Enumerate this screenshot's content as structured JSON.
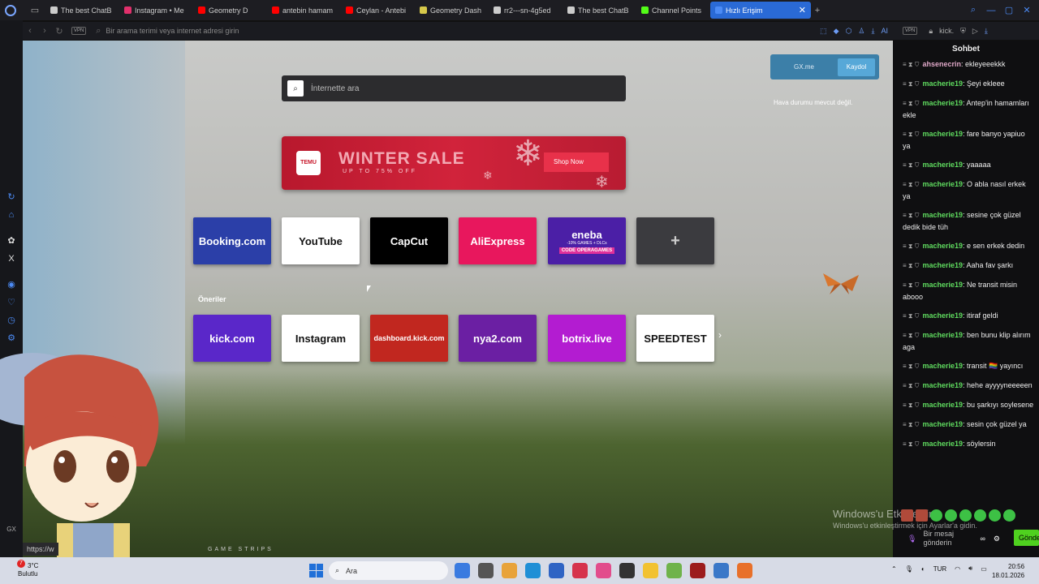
{
  "tabs": [
    {
      "label": "The best ChatB",
      "color": "#cccccc"
    },
    {
      "label": "Instagram • Me",
      "color": "#e1306c"
    },
    {
      "label": "Geometry D",
      "color": "#ff0000"
    },
    {
      "label": "antebin hamam",
      "color": "#ff0000"
    },
    {
      "label": "Ceylan - Antebi",
      "color": "#ff0000"
    },
    {
      "label": "Geometry Dash",
      "color": "#d6c84a"
    },
    {
      "label": "rr2---sn-4g5ed",
      "color": "#cccccc"
    },
    {
      "label": "The best ChatB",
      "color": "#cccccc"
    },
    {
      "label": "Channel Points",
      "color": "#53fc18"
    },
    {
      "label": "Hızlı Erişim",
      "color": "#4c8bf5",
      "active": true
    }
  ],
  "address": {
    "placeholder": "Bir arama terimi veya internet adresi girin",
    "vpn": "VPN",
    "ai": "AI"
  },
  "chat_top": {
    "vpn": "VPN",
    "site": "kick."
  },
  "speeddial": {
    "search_placeholder": "İnternette ara",
    "ad": {
      "title": "WINTER SALE",
      "subtitle": "UP TO 75% OFF",
      "cta": "Shop Now",
      "brand": "TEMU"
    },
    "gx": {
      "label": "GX.me",
      "button": "Kaydol"
    },
    "weather": "Hava durumu mevcut değil.",
    "suggestions_label": "Öneriler",
    "row1": [
      {
        "label": "Booking.com",
        "bg": "#2b3fa8",
        "fg": "#ffffff"
      },
      {
        "label": "YouTube",
        "bg": "#ffffff",
        "fg": "#111111"
      },
      {
        "label": "CapCut",
        "bg": "#000000",
        "fg": "#ffffff"
      },
      {
        "label": "AliExpress",
        "bg": "#e8175d",
        "fg": "#ffffff"
      },
      {
        "label": "eneba",
        "bg": "#4b1fa6",
        "fg": "#ffffff"
      },
      {
        "label": "+",
        "bg": "#3b3b3f",
        "fg": "#cccccc"
      }
    ],
    "row2": [
      {
        "label": "kick.com",
        "bg": "#5a27c9",
        "fg": "#ffffff"
      },
      {
        "label": "Instagram",
        "bg": "#ffffff",
        "fg": "#111111"
      },
      {
        "label": "dashboard.kick.com",
        "bg": "#c1271f",
        "fg": "#ffffff"
      },
      {
        "label": "nya2.com",
        "bg": "#6b1fa3",
        "fg": "#ffffff"
      },
      {
        "label": "botrix.live",
        "bg": "#b31cd1",
        "fg": "#ffffff"
      },
      {
        "label": "SPEEDTEST",
        "bg": "#ffffff",
        "fg": "#111111"
      }
    ],
    "eneba_sub": "-10% GAMES + DLCs",
    "eneba_code": "CODE OPERAGAMES",
    "game_strips": "GAME STRIPS",
    "url_hint": "https://w"
  },
  "chat": {
    "title": "Sohbet",
    "messages": [
      {
        "user": "ahsenecrin",
        "text": "ekleyeeekkk"
      },
      {
        "user": "macherie19",
        "text": "Şeyi ekleee"
      },
      {
        "user": "macherie19",
        "text": "Antep'in hamamları ekle"
      },
      {
        "user": "macherie19",
        "text": "fare banyo yapiuo ya"
      },
      {
        "user": "macherie19",
        "text": "yaaaaa"
      },
      {
        "user": "macherie19",
        "text": "O abla nasıl erkek ya"
      },
      {
        "user": "macherie19",
        "text": "sesine çok güzel dedik bide tüh"
      },
      {
        "user": "macherie19",
        "text": "e sen erkek dedin"
      },
      {
        "user": "macherie19",
        "text": "Aaha fav şarkı"
      },
      {
        "user": "macherie19",
        "text": "Ne transit misin abooo"
      },
      {
        "user": "macherie19",
        "text": "itiraf geldi"
      },
      {
        "user": "macherie19",
        "text": "ben bunu klip alırım aga"
      },
      {
        "user": "macherie19",
        "text": "transit 🏳️‍🌈 yayıncı"
      },
      {
        "user": "macherie19",
        "text": "hehe ayyyyneeeeen"
      },
      {
        "user": "macherie19",
        "text": "bu şarkıyı soylesene"
      },
      {
        "user": "macherie19",
        "text": "sesin çok güzel ya"
      },
      {
        "user": "macherie19",
        "text": "söylersin"
      }
    ],
    "input_placeholder": "Bir mesaj gönderin",
    "send": "Gönder",
    "windows_wm1": "Windows'u Etkinleştir",
    "windows_wm2": "Windows'u etkinleştirmek için Ayarlar'a gidin."
  },
  "taskbar": {
    "temp": "3°C",
    "cond": "Bulutlu",
    "badge": "7",
    "search": "Ara",
    "lang": "TUR",
    "time": "20:56",
    "date": "18.01.2026",
    "apps": [
      "#3a7be0",
      "#555555",
      "#e8a33a",
      "#1f8fd6",
      "#2f64c4",
      "#d6334b",
      "#e24d8c",
      "#333333",
      "#f2c230",
      "#6fb34a",
      "#9c1c1c",
      "#3a78c8",
      "#e8702a"
    ]
  }
}
